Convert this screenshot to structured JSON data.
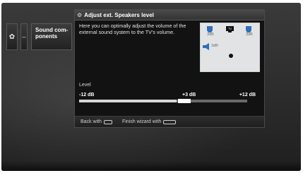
{
  "header": {
    "title": "Adjust ext. Speakers level"
  },
  "nav": {
    "gear_glyph": "✿",
    "dash": "–",
    "item_label": "Sound com-ponents"
  },
  "content": {
    "description": "Here you can optimally adjust the volume of the external sound system to the TV's volume.",
    "speaker_labels": {
      "left": "3dB",
      "right": "3dB",
      "center": "3dB"
    }
  },
  "level": {
    "label": "Level",
    "min": "-12 dB",
    "mid": "+3 dB",
    "max": "+12 dB",
    "position_fraction": 0.625,
    "fill_fraction": 0.58
  },
  "footer": {
    "back_label": "Back with",
    "finish_label": "Finish wizard with"
  },
  "icons": {
    "settings": "gear-icon",
    "speaker": "speaker-icon",
    "tv": "tv-icon",
    "listener": "listener-icon"
  },
  "colors": {
    "speaker_blue": "#2f6fb8",
    "panel_bg": "#121212"
  }
}
